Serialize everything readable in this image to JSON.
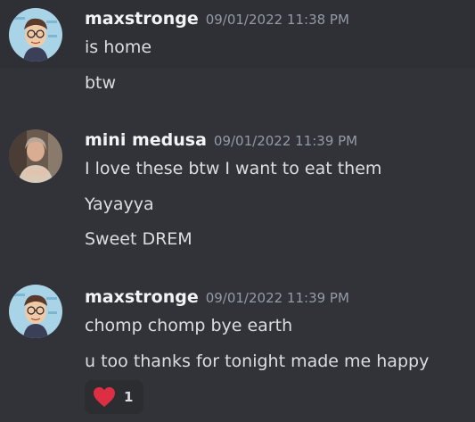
{
  "messages": [
    {
      "username": "maxstronge",
      "timestamp": "09/01/2022 11:38 PM",
      "lines": [
        "is home",
        "btw"
      ]
    },
    {
      "username": "mini medusa",
      "timestamp": "09/01/2022 11:39 PM",
      "lines": [
        "I love these btw I want to eat them",
        "Yayayya",
        "Sweet DREM"
      ]
    },
    {
      "username": "maxstronge",
      "timestamp": "09/01/2022 11:39 PM",
      "lines": [
        "chomp chomp bye earth",
        "u too thanks for tonight made me happy"
      ],
      "reaction": {
        "icon": "heart-icon",
        "count": "1",
        "color": "#dd2e44"
      }
    }
  ],
  "colors": {
    "background": "#313338",
    "highlight": "#2e3035",
    "username": "#f2f3f5",
    "timestamp": "#949ba4",
    "text": "#dbdee1"
  }
}
